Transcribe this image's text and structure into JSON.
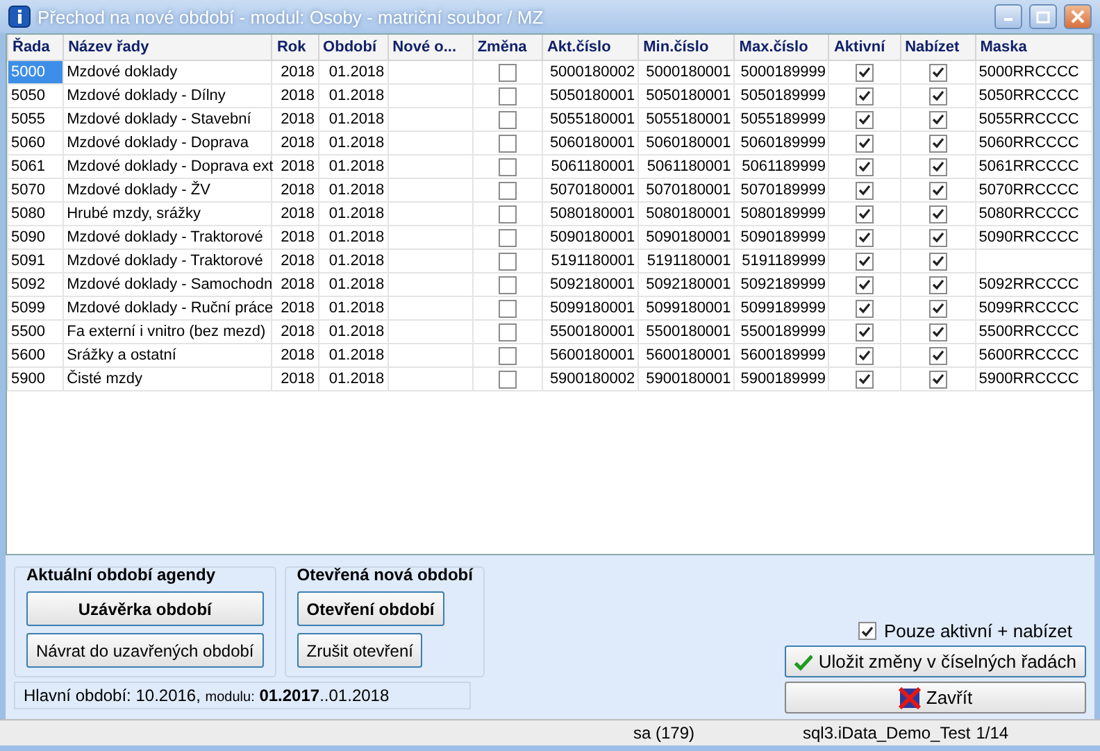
{
  "window": {
    "title": "Přechod na nové období - modul: Osoby - matriční soubor / MZ"
  },
  "table": {
    "columns": [
      "Řada",
      "Název řady",
      "Rok",
      "Období",
      "Nové o...",
      "Změna",
      "Akt.číslo",
      "Min.číslo",
      "Max.číslo",
      "Aktivní",
      "Nabízet",
      "Maska"
    ],
    "rows": [
      {
        "series": "5000",
        "name": "Mzdové doklady",
        "year": "2018",
        "period": "01.2018",
        "changed": false,
        "current": "5000180002",
        "min": "5000180001",
        "max": "5000189999",
        "active": true,
        "offer": true,
        "mask": "5000RRCCCC",
        "selected": true
      },
      {
        "series": "5050",
        "name": "Mzdové doklady - Dílny",
        "year": "2018",
        "period": "01.2018",
        "changed": false,
        "current": "5050180001",
        "min": "5050180001",
        "max": "5050189999",
        "active": true,
        "offer": true,
        "mask": "5050RRCCCC",
        "selected": false
      },
      {
        "series": "5055",
        "name": "Mzdové doklady - Stavební",
        "year": "2018",
        "period": "01.2018",
        "changed": false,
        "current": "5055180001",
        "min": "5055180001",
        "max": "5055189999",
        "active": true,
        "offer": true,
        "mask": "5055RRCCCC",
        "selected": false
      },
      {
        "series": "5060",
        "name": "Mzdové doklady - Doprava",
        "year": "2018",
        "period": "01.2018",
        "changed": false,
        "current": "5060180001",
        "min": "5060180001",
        "max": "5060189999",
        "active": true,
        "offer": true,
        "mask": "5060RRCCCC",
        "selected": false
      },
      {
        "series": "5061",
        "name": "Mzdové doklady - Doprava ext",
        "year": "2018",
        "period": "01.2018",
        "changed": false,
        "current": "5061180001",
        "min": "5061180001",
        "max": "5061189999",
        "active": true,
        "offer": true,
        "mask": "5061RRCCCC",
        "selected": false
      },
      {
        "series": "5070",
        "name": "Mzdové doklady - ŽV",
        "year": "2018",
        "period": "01.2018",
        "changed": false,
        "current": "5070180001",
        "min": "5070180001",
        "max": "5070189999",
        "active": true,
        "offer": true,
        "mask": "5070RRCCCC",
        "selected": false
      },
      {
        "series": "5080",
        "name": "Hrubé mzdy, srážky",
        "year": "2018",
        "period": "01.2018",
        "changed": false,
        "current": "5080180001",
        "min": "5080180001",
        "max": "5080189999",
        "active": true,
        "offer": true,
        "mask": "5080RRCCCC",
        "selected": false
      },
      {
        "series": "5090",
        "name": "Mzdové doklady - Traktorové",
        "year": "2018",
        "period": "01.2018",
        "changed": false,
        "current": "5090180001",
        "min": "5090180001",
        "max": "5090189999",
        "active": true,
        "offer": true,
        "mask": "5090RRCCCC",
        "selected": false
      },
      {
        "series": "5091",
        "name": "Mzdové doklady - Traktorové",
        "year": "2018",
        "period": "01.2018",
        "changed": false,
        "current": "5191180001",
        "min": "5191180001",
        "max": "5191189999",
        "active": true,
        "offer": true,
        "selected": false
      },
      {
        "series": "5092",
        "name": "Mzdové doklady - Samochodn",
        "year": "2018",
        "period": "01.2018",
        "changed": false,
        "current": "5092180001",
        "min": "5092180001",
        "max": "5092189999",
        "active": true,
        "offer": true,
        "mask": "5092RRCCCC",
        "selected": false
      },
      {
        "series": "5099",
        "name": "Mzdové doklady - Ruční práce",
        "year": "2018",
        "period": "01.2018",
        "changed": false,
        "current": "5099180001",
        "min": "5099180001",
        "max": "5099189999",
        "active": true,
        "offer": true,
        "mask": "5099RRCCCC",
        "selected": false
      },
      {
        "series": "5500",
        "name": "Fa externí  i vnitro (bez mezd)",
        "year": "2018",
        "period": "01.2018",
        "changed": false,
        "current": "5500180001",
        "min": "5500180001",
        "max": "5500189999",
        "active": true,
        "offer": true,
        "mask": "5500RRCCCC",
        "selected": false
      },
      {
        "series": "5600",
        "name": "Srážky a ostatní",
        "year": "2018",
        "period": "01.2018",
        "changed": false,
        "current": "5600180001",
        "min": "5600180001",
        "max": "5600189999",
        "active": true,
        "offer": true,
        "mask": "5600RRCCCC",
        "selected": false
      },
      {
        "series": "5900",
        "name": "Čisté mzdy",
        "year": "2018",
        "period": "01.2018",
        "changed": false,
        "current": "5900180002",
        "min": "5900180001",
        "max": "5900189999",
        "active": true,
        "offer": true,
        "mask": "5900RRCCCC",
        "selected": false
      }
    ]
  },
  "groups": [
    {
      "title": "Aktuální období agendy",
      "buttons": [
        {
          "label": "Uzávěrka období",
          "bold": true
        },
        {
          "label": "Návrat do uzavřených období",
          "bold": false
        }
      ]
    },
    {
      "title": "Otevřená nová období",
      "buttons": [
        {
          "label": "Otevření období",
          "bold": true
        },
        {
          "label": "Zrušit otevření",
          "bold": false
        }
      ]
    }
  ],
  "period_info": {
    "main": "Hlavní období: 10.2016,",
    "module_label": "modulu:",
    "module_period": "**01.2017**..01.2018"
  },
  "filter_checkbox": {
    "label": "Pouze aktivní + nabízet",
    "checked": true
  },
  "save_button": {
    "label": "Uložit změny v číselných řadách"
  },
  "close_button": {
    "label": "Zavřít"
  },
  "status_bar": [
    "sa (179)",
    "sql3.iData_Demo_Test",
    "1/14"
  ]
}
